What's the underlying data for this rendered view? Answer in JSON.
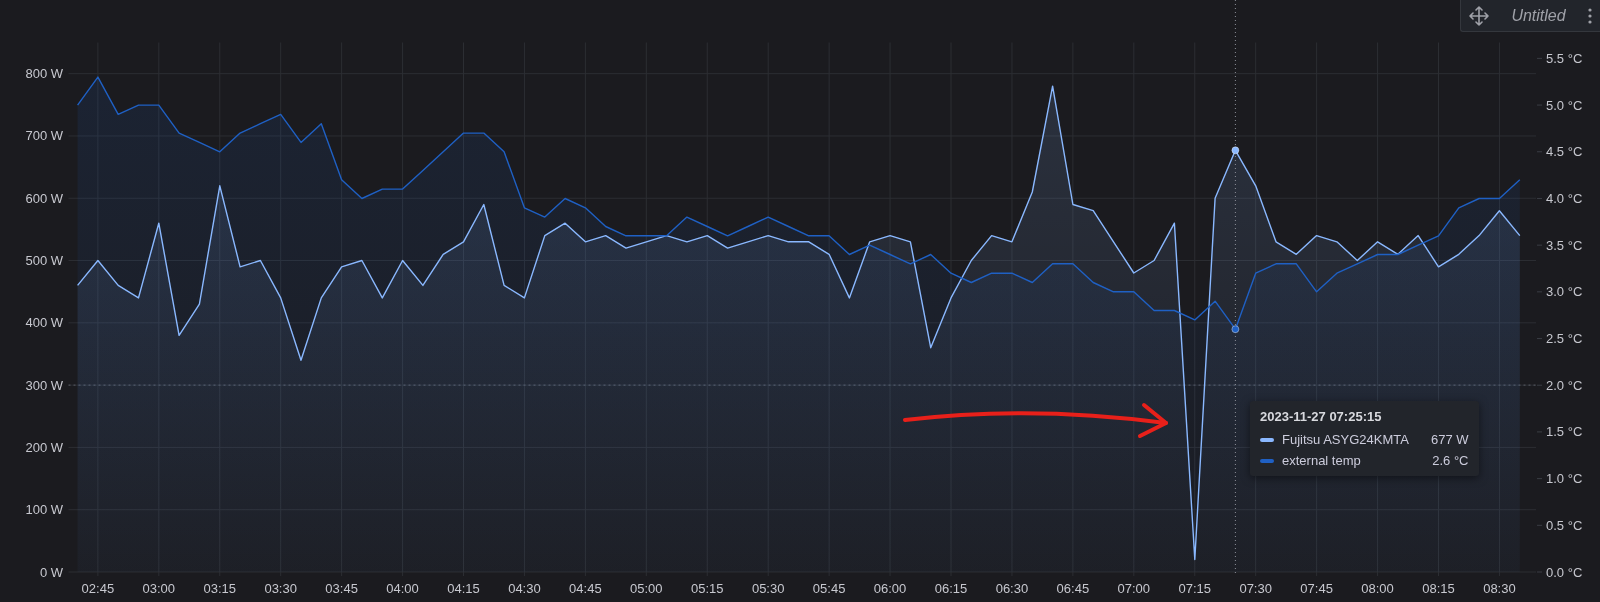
{
  "panel_header": {
    "title": "Untitled"
  },
  "chart_data": {
    "type": "area",
    "grid": true,
    "xlim": [
      159,
      519
    ],
    "ylim": [
      0,
      850
    ],
    "y2lim": [
      0,
      5.67
    ],
    "x": [
      160,
      165,
      170,
      175,
      180,
      185,
      190,
      195,
      200,
      205,
      210,
      215,
      220,
      225,
      230,
      235,
      240,
      245,
      250,
      255,
      260,
      265,
      270,
      275,
      280,
      285,
      290,
      295,
      300,
      305,
      310,
      315,
      320,
      325,
      330,
      335,
      340,
      345,
      350,
      355,
      360,
      365,
      370,
      375,
      380,
      385,
      390,
      395,
      400,
      405,
      410,
      415,
      420,
      425,
      430,
      435,
      440,
      445,
      450,
      455,
      460,
      465,
      470,
      475,
      480,
      485,
      490,
      495,
      500,
      505,
      510,
      515
    ],
    "series": [
      {
        "name": "Fujitsu ASYG24KMTA",
        "color": "#8ab8ff",
        "values": [
          460,
          500,
          460,
          440,
          560,
          380,
          430,
          620,
          490,
          500,
          440,
          340,
          440,
          490,
          500,
          440,
          500,
          460,
          510,
          530,
          590,
          460,
          440,
          540,
          560,
          530,
          540,
          520,
          530,
          540,
          530,
          540,
          520,
          530,
          540,
          530,
          530,
          510,
          440,
          530,
          540,
          530,
          360,
          440,
          500,
          540,
          530,
          610,
          780,
          590,
          580,
          530,
          480,
          500,
          560,
          20,
          600,
          677,
          620,
          530,
          510,
          540,
          530,
          500,
          530,
          510,
          540,
          490,
          510,
          540,
          580,
          540
        ]
      },
      {
        "name": "external temp",
        "color": "#1f60c4",
        "axis": "y2",
        "values": [
          5.0,
          5.3,
          4.9,
          5.0,
          5.0,
          4.7,
          4.6,
          4.5,
          4.7,
          4.8,
          4.9,
          4.6,
          4.8,
          4.2,
          4.0,
          4.1,
          4.1,
          4.3,
          4.5,
          4.7,
          4.7,
          4.5,
          3.9,
          3.8,
          4.0,
          3.9,
          3.7,
          3.6,
          3.6,
          3.6,
          3.8,
          3.7,
          3.6,
          3.7,
          3.8,
          3.7,
          3.6,
          3.6,
          3.4,
          3.5,
          3.4,
          3.3,
          3.4,
          3.2,
          3.1,
          3.2,
          3.2,
          3.1,
          3.3,
          3.3,
          3.1,
          3.0,
          3.0,
          2.8,
          2.8,
          2.7,
          2.9,
          2.6,
          3.2,
          3.3,
          3.3,
          3.0,
          3.2,
          3.3,
          3.4,
          3.4,
          3.5,
          3.6,
          3.9,
          4.0,
          4.0,
          4.2
        ]
      }
    ],
    "yticks": [
      {
        "value": 0,
        "label": "0 W"
      },
      {
        "value": 100,
        "label": "100 W"
      },
      {
        "value": 200,
        "label": "200 W"
      },
      {
        "value": 300,
        "label": "300 W"
      },
      {
        "value": 400,
        "label": "400 W"
      },
      {
        "value": 500,
        "label": "500 W"
      },
      {
        "value": 600,
        "label": "600 W"
      },
      {
        "value": 700,
        "label": "700 W"
      },
      {
        "value": 800,
        "label": "800 W"
      }
    ],
    "y2ticks": [
      {
        "value": 0,
        "label": "0.0 °C"
      },
      {
        "value": 0.5,
        "label": "0.5 °C"
      },
      {
        "value": 1,
        "label": "1.0 °C"
      },
      {
        "value": 1.5,
        "label": "1.5 °C"
      },
      {
        "value": 2,
        "label": "2.0 °C"
      },
      {
        "value": 2.5,
        "label": "2.5 °C"
      },
      {
        "value": 3,
        "label": "3.0 °C"
      },
      {
        "value": 3.5,
        "label": "3.5 °C"
      },
      {
        "value": 4,
        "label": "4.0 °C"
      },
      {
        "value": 4.5,
        "label": "4.5 °C"
      },
      {
        "value": 5,
        "label": "5.0 °C"
      },
      {
        "value": 5.5,
        "label": "5.5 °C"
      }
    ],
    "xticks": [
      {
        "value": 165,
        "label": "02:45"
      },
      {
        "value": 180,
        "label": "03:00"
      },
      {
        "value": 195,
        "label": "03:15"
      },
      {
        "value": 210,
        "label": "03:30"
      },
      {
        "value": 225,
        "label": "03:45"
      },
      {
        "value": 240,
        "label": "04:00"
      },
      {
        "value": 255,
        "label": "04:15"
      },
      {
        "value": 270,
        "label": "04:30"
      },
      {
        "value": 285,
        "label": "04:45"
      },
      {
        "value": 300,
        "label": "05:00"
      },
      {
        "value": 315,
        "label": "05:15"
      },
      {
        "value": 330,
        "label": "05:30"
      },
      {
        "value": 345,
        "label": "05:45"
      },
      {
        "value": 360,
        "label": "06:00"
      },
      {
        "value": 375,
        "label": "06:15"
      },
      {
        "value": 390,
        "label": "06:30"
      },
      {
        "value": 405,
        "label": "06:45"
      },
      {
        "value": 420,
        "label": "07:00"
      },
      {
        "value": 435,
        "label": "07:15"
      },
      {
        "value": 450,
        "label": "07:30"
      },
      {
        "value": 465,
        "label": "07:45"
      },
      {
        "value": 480,
        "label": "08:00"
      },
      {
        "value": 495,
        "label": "08:15"
      },
      {
        "value": 510,
        "label": "08:30"
      }
    ],
    "ref_lines": [
      {
        "axis": "y",
        "value": 300
      },
      {
        "axis": "x",
        "value": 445
      }
    ]
  },
  "tooltip": {
    "time": "2023-11-27 07:25:15",
    "rows": [
      {
        "value": "677 W"
      },
      {
        "value": "2.6 °C"
      }
    ]
  }
}
